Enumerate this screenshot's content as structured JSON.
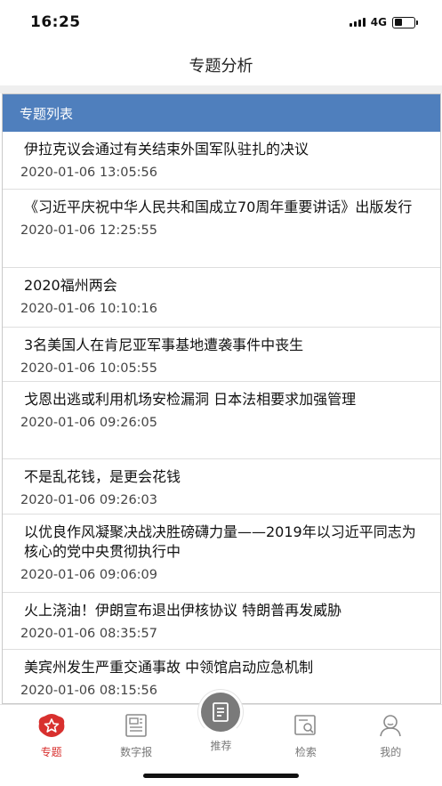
{
  "status_bar": {
    "time": "16:25",
    "network": "4G",
    "battery_level": 0.4
  },
  "nav": {
    "title": "专题分析"
  },
  "panel": {
    "header": "专题列表"
  },
  "items": [
    {
      "title": "伊拉克议会通过有关结束外国军队驻扎的决议",
      "date": "2020-01-06 13:05:56"
    },
    {
      "title": "《习近平庆祝中华人民共和国成立70周年重要讲话》出版发行",
      "date": "2020-01-06 12:25:55"
    },
    {
      "title": "2020福州两会",
      "date": "2020-01-06 10:10:16"
    },
    {
      "title": "3名美国人在肯尼亚军事基地遭袭事件中丧生",
      "date": "2020-01-06 10:05:55"
    },
    {
      "title": "戈恩出逃或利用机场安检漏洞 日本法相要求加强管理",
      "date": "2020-01-06 09:26:05"
    },
    {
      "title": "不是乱花钱，是更会花钱",
      "date": "2020-01-06 09:26:03"
    },
    {
      "title": "以优良作风凝聚决战决胜磅礴力量——2019年以习近平同志为核心的党中央贯彻执行中",
      "date": "2020-01-06 09:06:09"
    },
    {
      "title": "火上浇油！伊朗宣布退出伊核协议 特朗普再发威胁",
      "date": "2020-01-06 08:35:57"
    },
    {
      "title": "美宾州发生严重交通事故 中领馆启动应急机制",
      "date": "2020-01-06 08:15:56"
    }
  ],
  "tabs": [
    {
      "label": "专题",
      "icon": "star-badge-icon",
      "active": true
    },
    {
      "label": "数字报",
      "icon": "newspaper-icon",
      "active": false
    },
    {
      "label": "推荐",
      "icon": "document-icon",
      "active": false
    },
    {
      "label": "检索",
      "icon": "search-document-icon",
      "active": false
    },
    {
      "label": "我的",
      "icon": "user-icon",
      "active": false
    }
  ],
  "colors": {
    "header_blue": "#4f7fbd",
    "active_red": "#d8302e",
    "tab_gray": "#777777"
  }
}
